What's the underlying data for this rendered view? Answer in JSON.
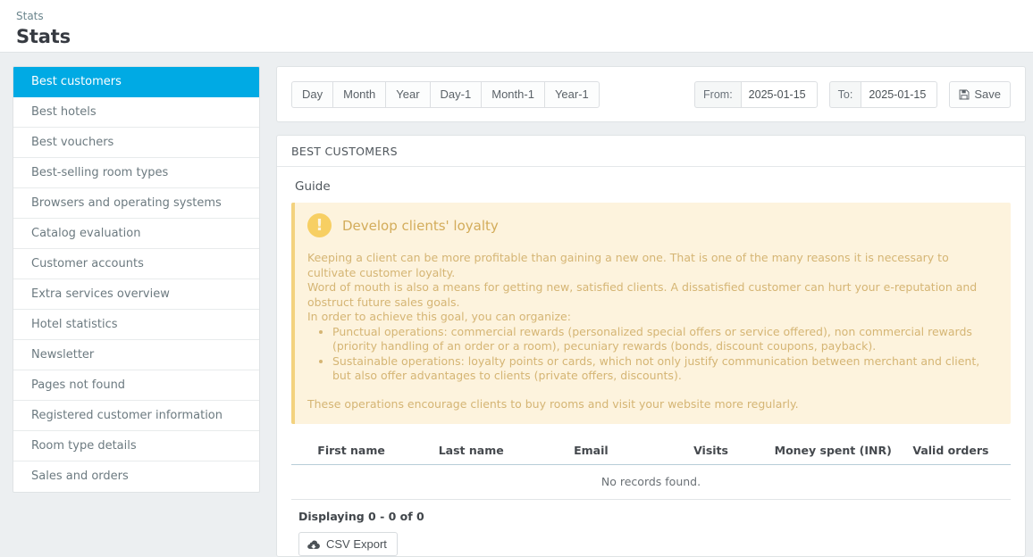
{
  "header": {
    "breadcrumb": "Stats",
    "title": "Stats"
  },
  "colors": {
    "accent": "#00aae4",
    "alert_bg": "#fdf3dd",
    "alert_border": "#f3d27e",
    "alert_text": "#d5b574",
    "page_bg": "#eceff1"
  },
  "sidebar": {
    "items": [
      {
        "label": "Best customers",
        "active": true
      },
      {
        "label": "Best hotels",
        "active": false
      },
      {
        "label": "Best vouchers",
        "active": false
      },
      {
        "label": "Best-selling room types",
        "active": false
      },
      {
        "label": "Browsers and operating systems",
        "active": false
      },
      {
        "label": "Catalog evaluation",
        "active": false
      },
      {
        "label": "Customer accounts",
        "active": false
      },
      {
        "label": "Extra services overview",
        "active": false
      },
      {
        "label": "Hotel statistics",
        "active": false
      },
      {
        "label": "Newsletter",
        "active": false
      },
      {
        "label": "Pages not found",
        "active": false
      },
      {
        "label": "Registered customer information",
        "active": false
      },
      {
        "label": "Room type details",
        "active": false
      },
      {
        "label": "Sales and orders",
        "active": false
      }
    ]
  },
  "toolbar": {
    "range_buttons": [
      {
        "label": "Day"
      },
      {
        "label": "Month"
      },
      {
        "label": "Year"
      },
      {
        "label": "Day-1"
      },
      {
        "label": "Month-1"
      },
      {
        "label": "Year-1"
      }
    ],
    "from_label": "From:",
    "from_value": "2025-01-15",
    "to_label": "To:",
    "to_value": "2025-01-15",
    "save_label": "Save",
    "save_icon": "floppy-disk-icon"
  },
  "panel": {
    "heading": "BEST CUSTOMERS",
    "guide_label": "Guide"
  },
  "alert": {
    "icon": "exclamation-circle-icon",
    "title": "Develop clients' loyalty",
    "paragraph_lines": [
      "Keeping a client can be more profitable than gaining a new one. That is one of the many reasons it is necessary to cultivate customer loyalty.",
      "Word of mouth is also a means for getting new, satisfied clients. A dissatisfied customer can hurt your e-reputation and obstruct future sales goals.",
      "In order to achieve this goal, you can organize:"
    ],
    "bullets": [
      "Punctual operations: commercial rewards (personalized special offers or service offered), non commercial rewards (priority handling of an order or a room), pecuniary rewards (bonds, discount coupons, payback).",
      "Sustainable operations: loyalty points or cards, which not only justify communication between merchant and client, but also offer advantages to clients (private offers, discounts)."
    ],
    "closing": "These operations encourage clients to buy rooms and visit your website more regularly."
  },
  "table": {
    "columns": [
      "First name",
      "Last name",
      "Email",
      "Visits",
      "Money spent (INR)",
      "Valid orders"
    ],
    "empty_message": "No records found.",
    "displaying": "Displaying 0 - 0 of 0",
    "export_label": "CSV Export",
    "export_icon": "cloud-download-icon"
  }
}
